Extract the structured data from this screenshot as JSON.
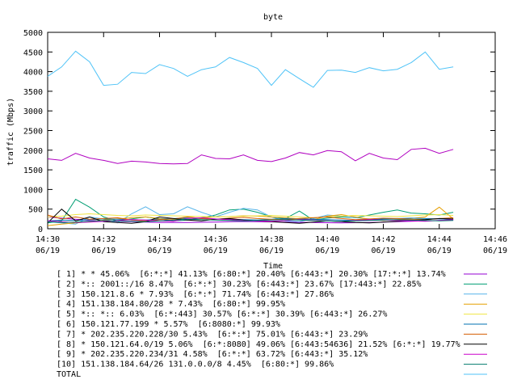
{
  "chart_data": {
    "type": "line",
    "title": "byte",
    "xlabel": "Time",
    "ylabel": "traffic (Mbps)",
    "ylim": [
      0,
      5000
    ],
    "xlim": [
      0,
      16
    ],
    "x_unit": "minutes after 14:30 on 06/19",
    "yticks": [
      0,
      500,
      1000,
      1500,
      2000,
      2500,
      3000,
      3500,
      4000,
      4500,
      5000
    ],
    "xticks": [
      {
        "x": 0,
        "time": "14:30",
        "date": "06/19"
      },
      {
        "x": 2,
        "time": "14:32",
        "date": "06/19"
      },
      {
        "x": 4,
        "time": "14:34",
        "date": "06/19"
      },
      {
        "x": 6,
        "time": "14:36",
        "date": "06/19"
      },
      {
        "x": 8,
        "time": "14:38",
        "date": "06/19"
      },
      {
        "x": 10,
        "time": "14:40",
        "date": "06/19"
      },
      {
        "x": 12,
        "time": "14:42",
        "date": "06/19"
      },
      {
        "x": 14,
        "time": "14:44",
        "date": "06/19"
      },
      {
        "x": 16,
        "time": "14:46",
        "date": "06/19"
      }
    ],
    "x": [
      0,
      0.5,
      1,
      1.5,
      2,
      2.5,
      3,
      3.5,
      4,
      4.5,
      5,
      5.5,
      6,
      6.5,
      7,
      7.5,
      8,
      8.5,
      9,
      9.5,
      10,
      10.5,
      11,
      11.5,
      12,
      12.5,
      13,
      13.5,
      14,
      14.5
    ],
    "grid": false,
    "legend_position": "bottom",
    "series": [
      {
        "name": "[ 1] * * 45.06%  [6:*:*] 41.13% [6:80:*] 20.40% [6:443:*] 20.30% [17:*:*] 13.74%",
        "color": "#9400d3",
        "values": [
          300,
          270,
          240,
          210,
          200,
          190,
          180,
          170,
          160,
          160,
          160,
          165,
          170,
          180,
          185,
          180,
          175,
          170,
          165,
          160,
          155,
          150,
          155,
          160,
          170,
          180,
          190,
          200,
          210,
          220
        ]
      },
      {
        "name": "[ 2] *:: 2001::/16 8.47%  [6:*:*] 30.23% [6:443:*] 23.67% [17:443:*] 22.85%",
        "color": "#009e73",
        "values": [
          150,
          200,
          750,
          550,
          300,
          200,
          250,
          300,
          250,
          200,
          220,
          280,
          350,
          480,
          500,
          420,
          300,
          260,
          450,
          220,
          270,
          300,
          280,
          350,
          420,
          480,
          400,
          380,
          350,
          420
        ]
      },
      {
        "name": "[ 3] 150.121.8.6 * 7.93%  [6:*:*] 71.74% [6:443:*] 27.86%",
        "color": "#56b4e9",
        "values": [
          180,
          150,
          120,
          300,
          250,
          150,
          380,
          560,
          360,
          380,
          560,
          420,
          300,
          420,
          520,
          480,
          300,
          200,
          180,
          260,
          350,
          320,
          280,
          250,
          230,
          220,
          210,
          240,
          260,
          220
        ]
      },
      {
        "name": "[ 4] 151.138.184.80/28 * 7.43%  [6:80:*] 99.95%",
        "color": "#e69f00",
        "values": [
          80,
          120,
          150,
          180,
          220,
          250,
          280,
          300,
          260,
          240,
          260,
          280,
          300,
          310,
          330,
          320,
          300,
          280,
          250,
          230,
          320,
          360,
          300,
          240,
          210,
          230,
          260,
          300,
          550,
          250
        ]
      },
      {
        "name": "[ 5] *:: *:: 6.03%  [6:*:443] 30.57% [6:*:*] 30.39% [6:443:*] 26.27%",
        "color": "#f0e442",
        "values": [
          300,
          320,
          360,
          380,
          360,
          340,
          330,
          350,
          340,
          330,
          320,
          310,
          300,
          310,
          320,
          330,
          340,
          320,
          300,
          280,
          300,
          320,
          340,
          330,
          320,
          310,
          330,
          350,
          360,
          340
        ]
      },
      {
        "name": "[ 6] 150.121.77.199 * 5.57%  [6:8080:*] 99.93%",
        "color": "#0072b2",
        "values": [
          200,
          220,
          210,
          230,
          250,
          240,
          230,
          220,
          240,
          260,
          270,
          260,
          250,
          240,
          230,
          220,
          240,
          260,
          250,
          240,
          230,
          220,
          210,
          230,
          250,
          260,
          270,
          260,
          250,
          240
        ]
      },
      {
        "name": "[ 7] * 202.235.220.228/30 5.43%  [6:*:*] 75.01% [6:443:*] 23.29%",
        "color": "#d55e00",
        "values": [
          350,
          250,
          300,
          240,
          260,
          280,
          220,
          200,
          230,
          250,
          300,
          260,
          240,
          270,
          290,
          260,
          240,
          230,
          260,
          280,
          300,
          260,
          230,
          250,
          270,
          260,
          240,
          230,
          260,
          280
        ]
      },
      {
        "name": "[ 8] * 150.121.64.0/19 5.06%  [6:*:8080] 49.06% [6:443:54636] 21.52% [6:*:*] 19.77%",
        "color": "#000000",
        "values": [
          150,
          500,
          200,
          300,
          180,
          160,
          140,
          180,
          300,
          260,
          220,
          200,
          240,
          260,
          220,
          200,
          180,
          160,
          140,
          170,
          200,
          180,
          160,
          150,
          170,
          190,
          210,
          230,
          260,
          250
        ]
      },
      {
        "name": "[ 9] * 202.235.220.234/31 4.58%  [6:*:*] 63.72% [6:443:*] 35.12%",
        "color": "#cc00cc",
        "values": [
          200,
          180,
          160,
          170,
          190,
          210,
          230,
          220,
          200,
          190,
          260,
          280,
          250,
          230,
          210,
          200,
          190,
          210,
          230,
          220,
          200,
          190,
          210,
          230,
          220,
          210,
          200,
          190,
          210,
          230
        ]
      },
      {
        "name": "[10] 151.138.184.64/26 131.0.0.0/8 4.45%  [6:80:*] 99.86%",
        "color": "#00796b",
        "values": [
          180,
          160,
          170,
          190,
          210,
          200,
          190,
          180,
          200,
          220,
          240,
          230,
          220,
          210,
          200,
          210,
          220,
          230,
          220,
          210,
          200,
          190,
          200,
          210,
          220,
          230,
          220,
          210,
          200,
          210
        ]
      },
      {
        "name": "TOTAL",
        "color": "#4fc3f7",
        "values": [
          3880,
          4120,
          4520,
          4250,
          3650,
          3680,
          3980,
          3950,
          4180,
          4080,
          3880,
          4050,
          4120,
          4360,
          4230,
          4080,
          3650,
          4050,
          3820,
          3600,
          4030,
          4040,
          3980,
          4100,
          4020,
          4060,
          4230,
          4500,
          4060,
          4120
        ]
      },
      {
        "name": "",
        "color": "#b000c0",
        "values": [
          1780,
          1740,
          1920,
          1800,
          1740,
          1660,
          1720,
          1700,
          1660,
          1650,
          1660,
          1880,
          1790,
          1780,
          1880,
          1740,
          1710,
          1800,
          1940,
          1880,
          1990,
          1960,
          1730,
          1920,
          1800,
          1760,
          2020,
          2050,
          1920,
          2020
        ]
      }
    ]
  }
}
